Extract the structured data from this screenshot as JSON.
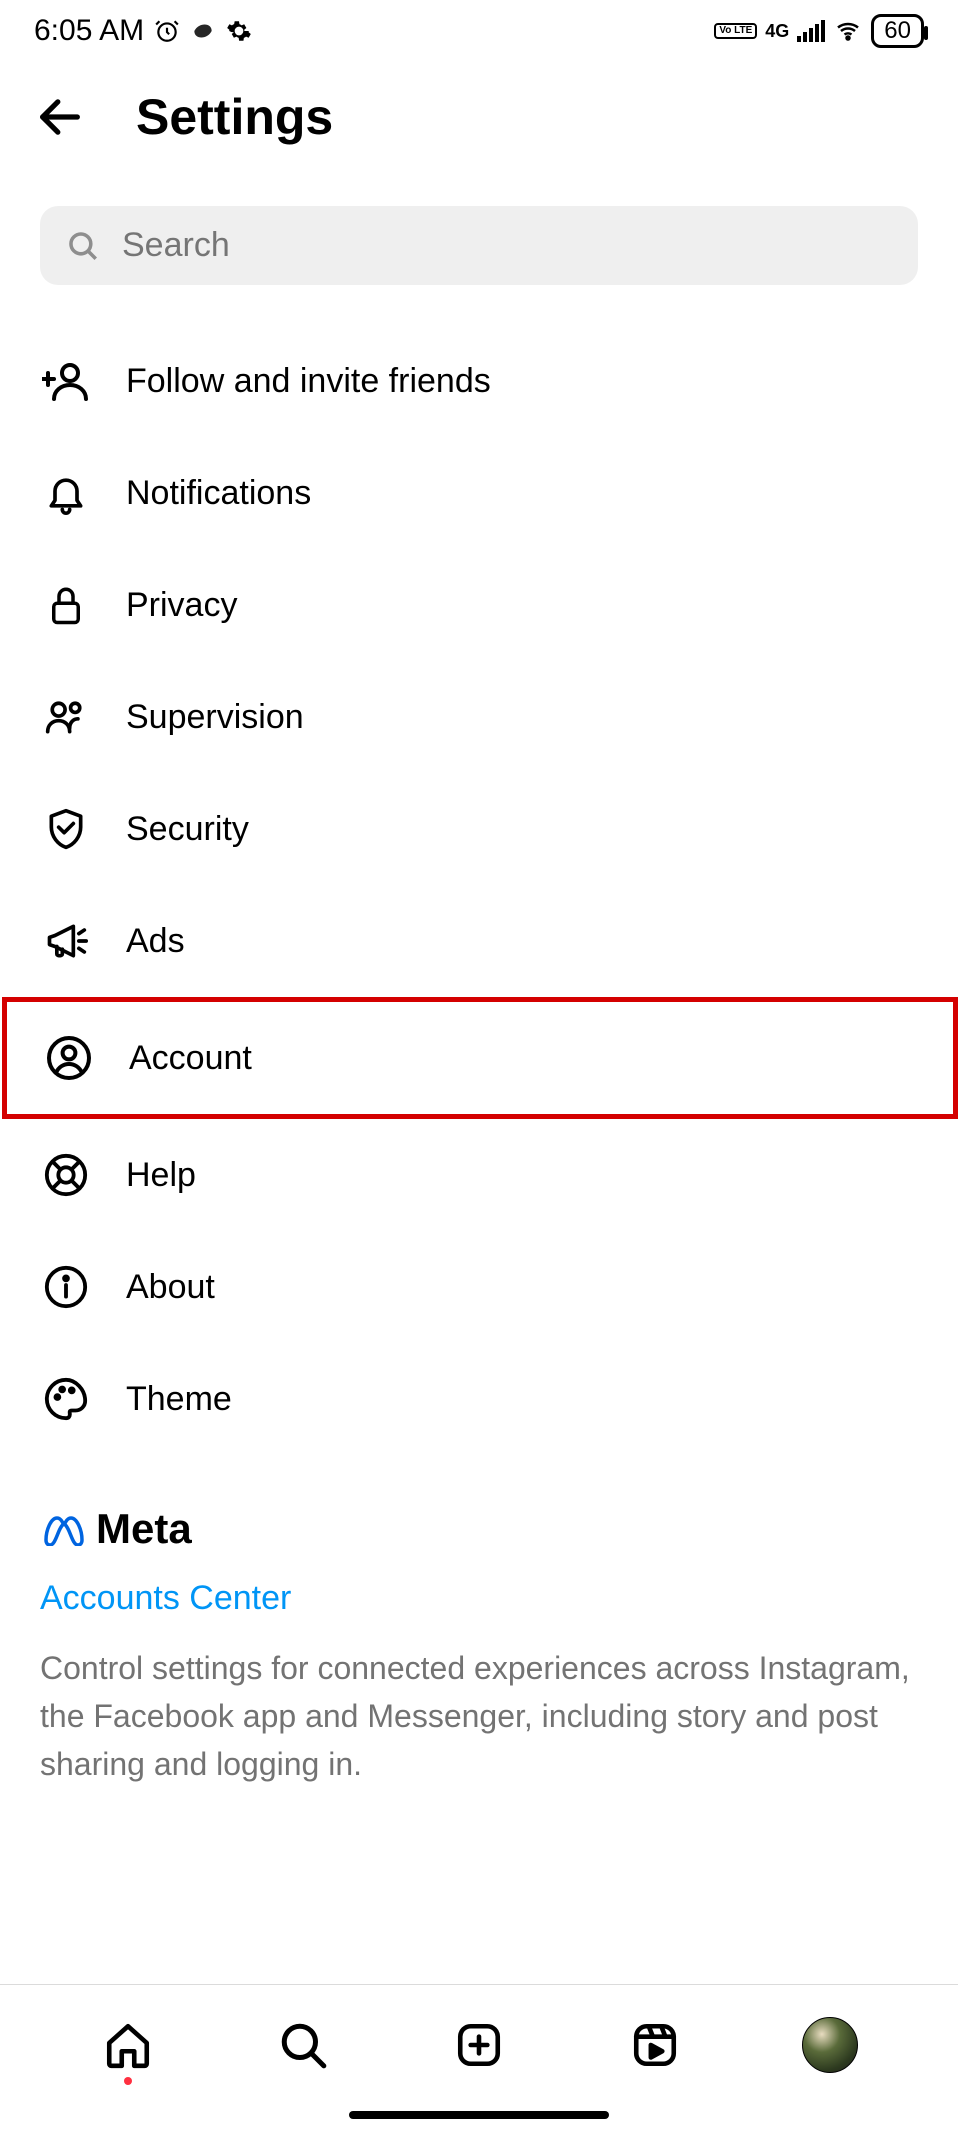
{
  "status": {
    "time": "6:05 AM",
    "network_label": "4G",
    "volte_label": "Vo LTE",
    "battery": "60"
  },
  "header": {
    "title": "Settings"
  },
  "search": {
    "placeholder": "Search"
  },
  "menu": {
    "items": [
      {
        "label": "Follow and invite friends",
        "icon": "person-add-icon"
      },
      {
        "label": "Notifications",
        "icon": "bell-icon"
      },
      {
        "label": "Privacy",
        "icon": "lock-icon"
      },
      {
        "label": "Supervision",
        "icon": "people-icon"
      },
      {
        "label": "Security",
        "icon": "shield-check-icon"
      },
      {
        "label": "Ads",
        "icon": "megaphone-icon"
      },
      {
        "label": "Account",
        "icon": "person-circle-icon",
        "highlighted": true
      },
      {
        "label": "Help",
        "icon": "lifebuoy-icon"
      },
      {
        "label": "About",
        "icon": "info-icon"
      },
      {
        "label": "Theme",
        "icon": "palette-icon"
      }
    ]
  },
  "meta": {
    "brand": "Meta",
    "link": "Accounts Center",
    "description": "Control settings for connected experiences across Instagram, the Facebook app and Messenger, including story and post sharing and logging in."
  },
  "colors": {
    "link": "#0095f6",
    "highlight": "#d40000",
    "muted": "#737373",
    "search_bg": "#efefef"
  }
}
